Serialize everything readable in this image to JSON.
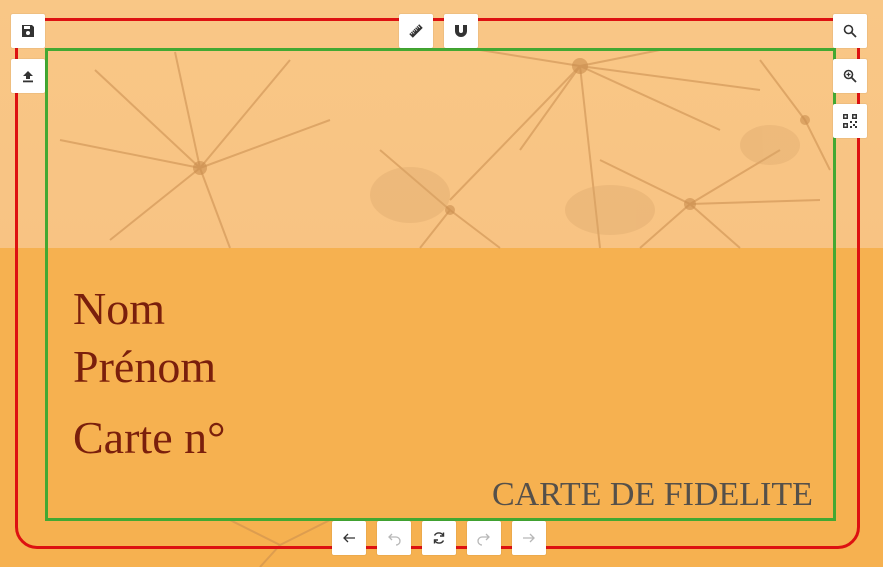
{
  "card": {
    "name_label": "Nom",
    "firstname_label": "Prénom",
    "card_number_label": "Carte n°",
    "title": "CARTE DE FIDELITE"
  },
  "colors": {
    "background": "#f6b150",
    "bleed_border": "#dd1111",
    "safe_border": "#43a832",
    "text": "#7a1f0c",
    "title_text": "#55504a"
  },
  "toolbar": {
    "top_left": [
      {
        "icon": "save-icon"
      },
      {
        "icon": "upload-icon"
      }
    ],
    "top_center": [
      {
        "icon": "ruler-icon"
      },
      {
        "icon": "magnet-icon"
      }
    ],
    "right": [
      {
        "icon": "search-icon"
      },
      {
        "icon": "zoom-in-icon"
      },
      {
        "icon": "qr-code-icon"
      }
    ],
    "bottom": [
      {
        "icon": "arrow-left-icon",
        "enabled": true
      },
      {
        "icon": "undo-icon",
        "enabled": false
      },
      {
        "icon": "rotate-icon",
        "enabled": true
      },
      {
        "icon": "redo-icon",
        "enabled": false
      },
      {
        "icon": "arrow-right-icon",
        "enabled": false
      }
    ]
  }
}
